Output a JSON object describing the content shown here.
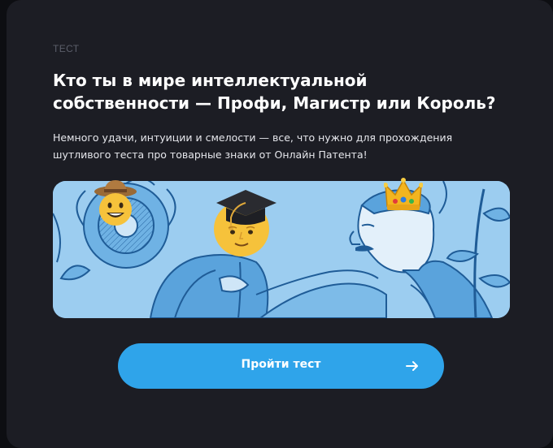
{
  "card": {
    "kicker": "ТЕСТ",
    "title": "Кто ты в мире интеллектуальной собственности — Профи, Магистр или Король?",
    "description": "Немного удачи, интуиции и смелости — все, что нужно для прохождения шутливого теста про товарные знаки от Онлайн Патента!"
  },
  "illustration": {
    "icons": [
      "cowboy-emoji-icon",
      "graduation-cap-emoji-icon",
      "crown-emoji-icon",
      "arrow-right-icon"
    ]
  },
  "cta": {
    "label": "Пройти тест"
  },
  "colors": {
    "background": "#1c1d24",
    "accent": "#2fa4ea",
    "banner": "#8fc6ec",
    "banner_ink": "#1f5c97"
  }
}
